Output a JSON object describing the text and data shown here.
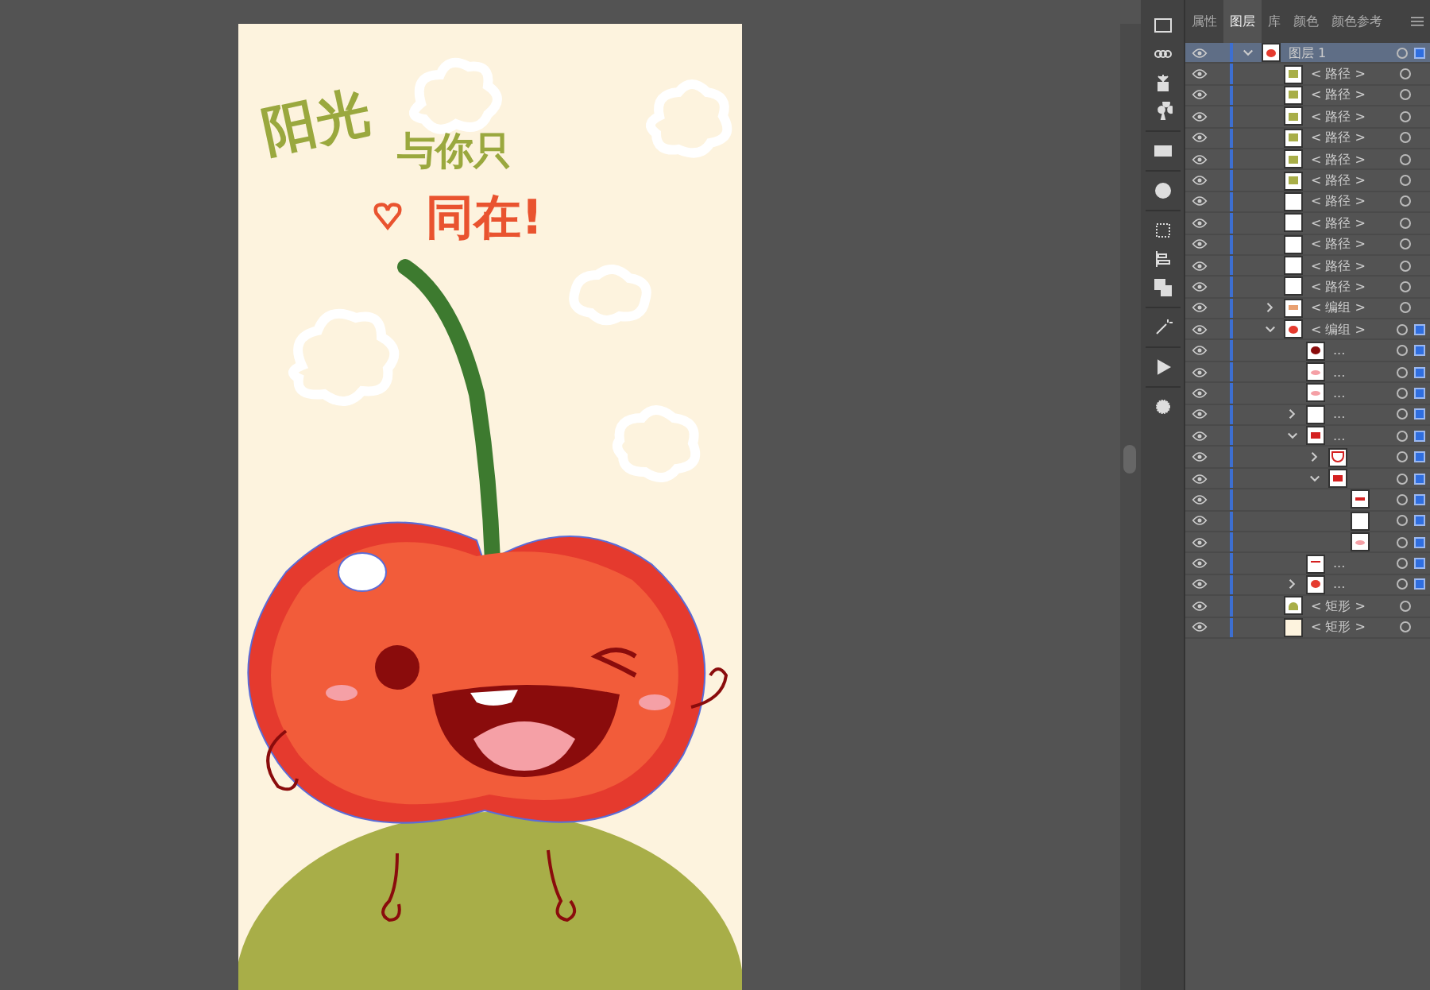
{
  "artboard": {
    "lines": [
      {
        "text": "阳光",
        "color": "#9aa83e"
      },
      {
        "text": "与你只",
        "color": "#9aa83e"
      },
      {
        "text": "同在!",
        "color": "#e9532f"
      }
    ]
  },
  "panel": {
    "tabs": [
      {
        "label": "属性",
        "selected": false
      },
      {
        "label": "图层",
        "selected": true
      },
      {
        "label": "库",
        "selected": false
      },
      {
        "label": "颜色",
        "selected": false
      },
      {
        "label": "颜色参考",
        "selected": false
      }
    ],
    "layers": [
      {
        "label": "图层 1",
        "kind": "layer",
        "expanded": true,
        "selected": true,
        "highlighted": true,
        "children": [
          {
            "label": "< 路径 >",
            "kind": "grass",
            "selected": false
          },
          {
            "label": "< 路径 >",
            "kind": "grass",
            "selected": false
          },
          {
            "label": "< 路径 >",
            "kind": "grass",
            "selected": false
          },
          {
            "label": "< 路径 >",
            "kind": "grass",
            "selected": false
          },
          {
            "label": "< 路径 >",
            "kind": "grass",
            "selected": false
          },
          {
            "label": "< 路径 >",
            "kind": "grass",
            "selected": false
          },
          {
            "label": "< 路径 >",
            "kind": "blank",
            "selected": false
          },
          {
            "label": "< 路径 >",
            "kind": "blank",
            "selected": false
          },
          {
            "label": "< 路径 >",
            "kind": "blank",
            "selected": false
          },
          {
            "label": "< 路径 >",
            "kind": "blank",
            "selected": false
          },
          {
            "label": "< 路径 >",
            "kind": "blank",
            "selected": false
          },
          {
            "label": "< 编组 >",
            "kind": "text",
            "expanded": false,
            "selected": false
          },
          {
            "label": "< 编组 >",
            "kind": "cherry",
            "expanded": true,
            "selected": true,
            "children": [
              {
                "label": "...",
                "kind": "eye",
                "selected": true
              },
              {
                "label": "...",
                "kind": "blush",
                "selected": true
              },
              {
                "label": "...",
                "kind": "blush",
                "selected": true
              },
              {
                "label": "...",
                "kind": "blank",
                "expanded": false,
                "selected": true
              },
              {
                "label": "...",
                "kind": "mouth",
                "expanded": true,
                "selected": true,
                "children": [
                  {
                    "kind": "outline",
                    "expanded": false,
                    "selected": true
                  },
                  {
                    "kind": "mouth",
                    "expanded": true,
                    "selected": true,
                    "children": [
                      {
                        "kind": "teeth",
                        "selected": true
                      },
                      {
                        "kind": "blank",
                        "selected": true
                      },
                      {
                        "kind": "blush",
                        "selected": true
                      }
                    ]
                  }
                ]
              },
              {
                "label": "...",
                "kind": "wink",
                "selected": true
              },
              {
                "label": "...",
                "kind": "cherry",
                "expanded": false,
                "selected": true
              }
            ]
          },
          {
            "label": "< 矩形 >",
            "kind": "hill",
            "selected": false
          },
          {
            "label": "< 矩形 >",
            "kind": "cream",
            "selected": false
          }
        ]
      }
    ]
  }
}
